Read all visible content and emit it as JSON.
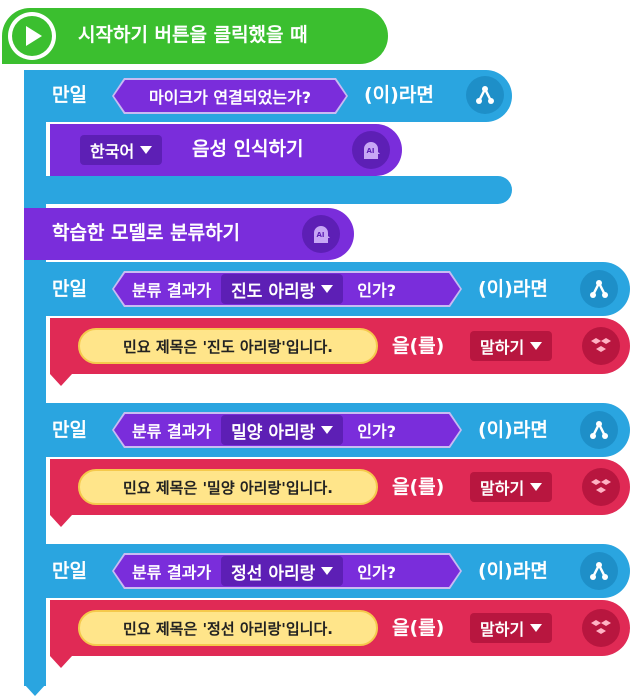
{
  "start": {
    "label": "시작하기 버튼을 클릭했을 때"
  },
  "if1": {
    "prefix": "만일",
    "condition": "마이크가 연결되었는가?",
    "suffix": "(이)라면"
  },
  "stt": {
    "language": "한국어",
    "label": "음성 인식하기",
    "icon": "AI"
  },
  "classify": {
    "label": "학습한 모델로 분류하기",
    "icon": "AI"
  },
  "branches": [
    {
      "prefix": "만일",
      "cond_label": "분류 결과가",
      "cond_value": "진도 아리랑",
      "cond_suffix": "인가?",
      "suffix": "(이)라면",
      "text": "민요 제목은 '진도 아리랑'입니다.",
      "particle": "을(를)",
      "action": "말하기"
    },
    {
      "prefix": "만일",
      "cond_label": "분류 결과가",
      "cond_value": "밀양 아리랑",
      "cond_suffix": "인가?",
      "suffix": "(이)라면",
      "text": "민요 제목은 '밀양 아리랑'입니다.",
      "particle": "을(를)",
      "action": "말하기"
    },
    {
      "prefix": "만일",
      "cond_label": "분류 결과가",
      "cond_value": "정선 아리랑",
      "cond_suffix": "인가?",
      "suffix": "(이)라면",
      "text": "민요 제목은 '정선 아리랑'입니다.",
      "particle": "을(를)",
      "action": "말하기"
    }
  ],
  "colors": {
    "start": "#3bbf2f",
    "flow": "#2aa5e0",
    "ai": "#7a2ddb",
    "speak": "#e02a55",
    "text_pill": "#ffe58a"
  }
}
